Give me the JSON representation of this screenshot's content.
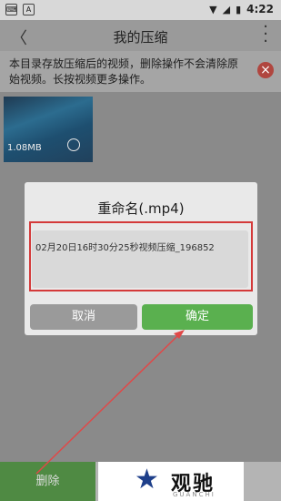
{
  "status_bar": {
    "time": "4:22"
  },
  "app_bar": {
    "title": "我的压缩"
  },
  "notice": {
    "text": "本目录存放压缩后的视频，删除操作不会清除原始视频。长按视频更多操作。"
  },
  "video": {
    "size": "1.08MB"
  },
  "dialog": {
    "title": "重命名(.mp4)",
    "input_value": "02月20日16时30分25秒视频压缩_196852",
    "cancel_label": "取消",
    "confirm_label": "确定"
  },
  "bottom_bar": {
    "delete_label": "删除"
  },
  "watermark": {
    "cn": "观驰",
    "en": "GUANCHI"
  },
  "colors": {
    "confirm": "#5ab04f",
    "highlight": "#d43a3a",
    "delete_bg": "#4f8a43"
  }
}
